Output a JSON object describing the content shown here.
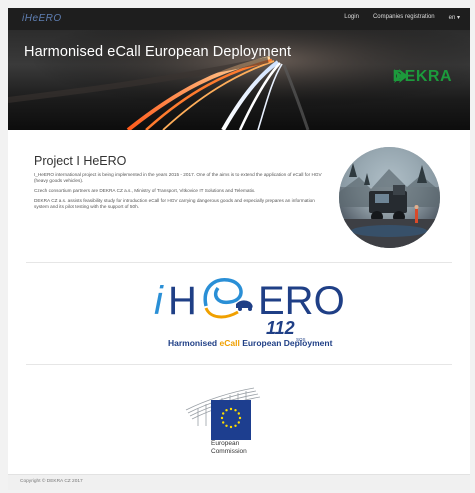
{
  "header": {
    "logo_text": "iHeERO",
    "nav": {
      "login": "Login",
      "companies_registration": "Companies registration",
      "language": "en ▾"
    }
  },
  "hero": {
    "title": "Harmonised eCall European Deployment",
    "partner_logo": "DEKRA"
  },
  "project": {
    "title": "Project I HeERO",
    "paragraphs": [
      "I_HeERO international project is being implemented in the years 2015 - 2017. One of the aims is to extend the application of eCall for HGV (heavy goods vehicles).",
      "Czech consortium partners are DEKRA CZ a.s., Ministry of Transport, Vitkovice IT Solutions and Telematix.",
      "DEKRA CZ a.s. assists feasibility study for introduction eCall for HGV carrying dangerous goods and especially prepares an information system and its pilot testing with the support of 50h."
    ]
  },
  "logos": {
    "ihero_main": "ERO",
    "ihero_number": "112",
    "ihero_sos": "SOS",
    "ihero_tagline_prefix": "Harmonised ",
    "ihero_tagline_ecall": "eCall",
    "ihero_tagline_suffix": " European Deployment",
    "ec_line1": "European",
    "ec_line2": "Commission"
  },
  "footer": {
    "copyright": "Copyright © DEKRA CZ   2017"
  },
  "colors": {
    "topbar": "#1e1e1e",
    "dekra_green": "#1c9a3c",
    "ihero_blue": "#1f3f86",
    "ihero_light_blue": "#2a8fd6",
    "ecall_orange": "#f0a000",
    "eu_blue": "#1d3e8f",
    "eu_star": "#ffdd00"
  }
}
